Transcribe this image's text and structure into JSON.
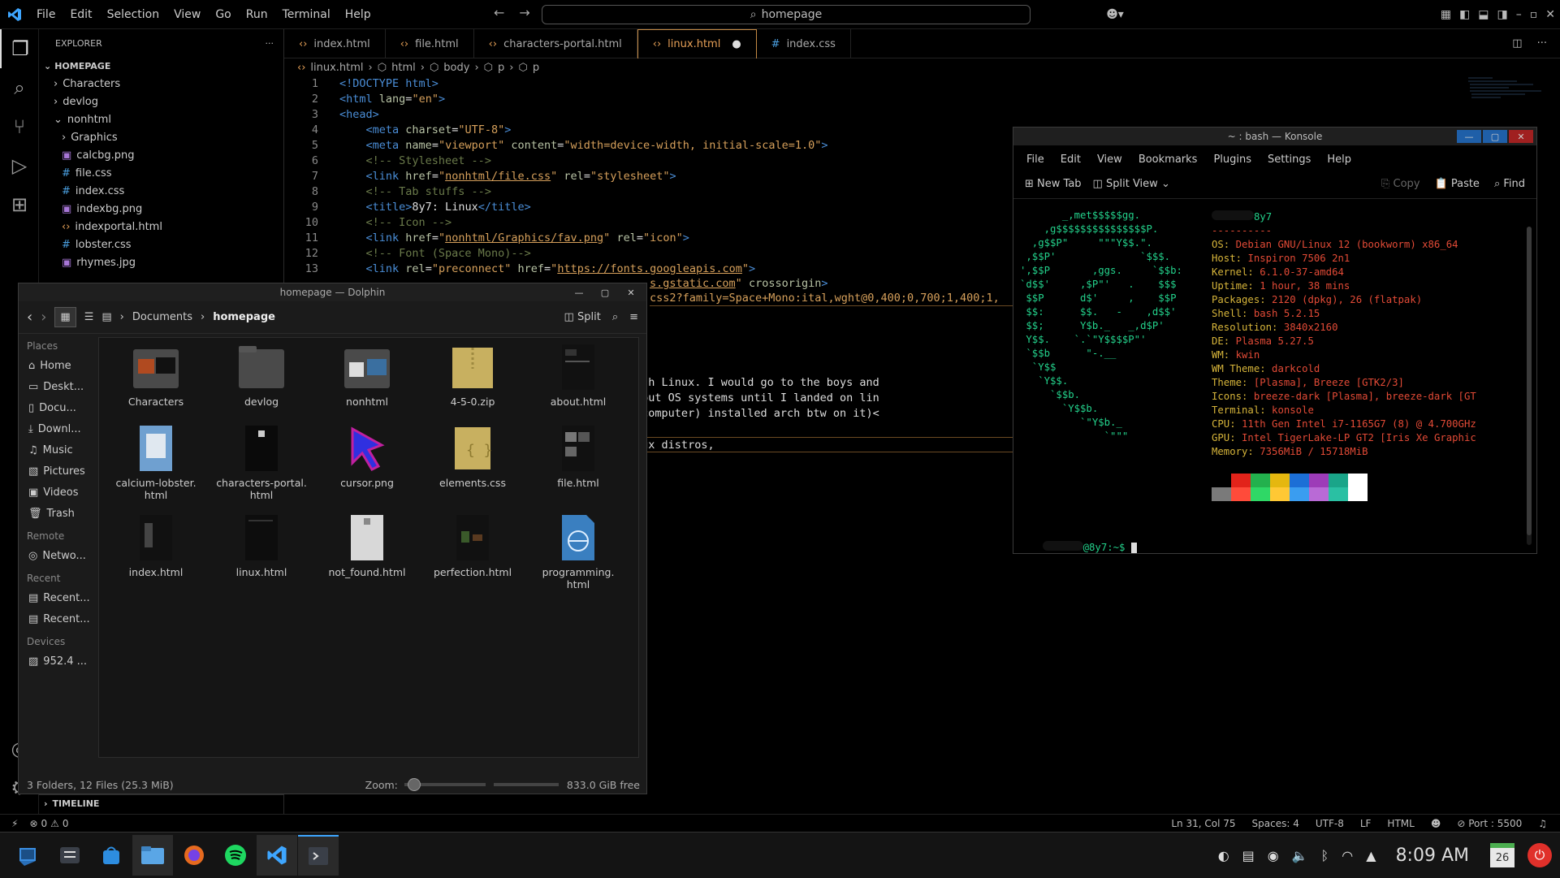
{
  "menu": [
    "File",
    "Edit",
    "Selection",
    "View",
    "Go",
    "Run",
    "Terminal",
    "Help"
  ],
  "command_center": "homepage",
  "explorer": {
    "title": "EXPLORER",
    "root": "HOMEPAGE",
    "items": [
      {
        "label": "Characters",
        "kind": "folder"
      },
      {
        "label": "devlog",
        "kind": "folder"
      },
      {
        "label": "nonhtml",
        "kind": "folder-open"
      },
      {
        "label": "Graphics",
        "kind": "folder"
      },
      {
        "label": "calcbg.png",
        "kind": "img"
      },
      {
        "label": "file.css",
        "kind": "css"
      },
      {
        "label": "index.css",
        "kind": "css"
      },
      {
        "label": "indexbg.png",
        "kind": "img"
      },
      {
        "label": "indexportal.html",
        "kind": "html"
      },
      {
        "label": "lobster.css",
        "kind": "css"
      },
      {
        "label": "rhymes.jpg",
        "kind": "img"
      }
    ],
    "timeline": "TIMELINE"
  },
  "tabs": [
    "index.html",
    "file.html",
    "characters-portal.html",
    "linux.html",
    "index.css"
  ],
  "breadcrumb": [
    "linux.html",
    "html",
    "body",
    "p",
    "p"
  ],
  "code_lines": [
    "1",
    "2",
    "3",
    "4",
    "5",
    "6",
    "7",
    "8",
    "9",
    "10",
    "11",
    "12",
    "13"
  ],
  "code_right": [
    "css2?family=Space+Mono:ital,wght@0,400;0,700;1,400;1,",
    "ame infatuated with Linux. I would go to the boys and",
    "uter for testing out OS systems until I landed on lin",
    "a different club computer) installed arch btw on it)<",
    "rfixation for linux distros,"
  ],
  "statusbar": {
    "errors": "0",
    "warnings": "0",
    "position": "Ln 31, Col 75",
    "spaces": "Spaces: 4",
    "encoding": "UTF-8",
    "eol": "LF",
    "language": "HTML",
    "port": "Port : 5500"
  },
  "dolphin": {
    "title": "homepage — Dolphin",
    "path": [
      "Documents",
      "homepage"
    ],
    "split": "Split",
    "places_head": "Places",
    "places": [
      "Home",
      "Deskt...",
      "Docu...",
      "Downl...",
      "Music",
      "Pictures",
      "Videos",
      "Trash"
    ],
    "remote_head": "Remote",
    "remote": [
      "Netwo..."
    ],
    "recent_head": "Recent",
    "recent": [
      "Recent...",
      "Recent..."
    ],
    "devices_head": "Devices",
    "devices": [
      "952.4 ..."
    ],
    "files": [
      "Characters",
      "devlog",
      "nonhtml",
      "4-5-0.zip",
      "about.html",
      "calcium-lobster.\nhtml",
      "characters-portal.\nhtml",
      "cursor.png",
      "elements.css",
      "file.html",
      "index.html",
      "linux.html",
      "not_found.html",
      "perfection.html",
      "programming.\nhtml"
    ],
    "status": "3 Folders, 12 Files (25.3 MiB)",
    "zoom_label": "Zoom:",
    "free": "833.0 GiB free"
  },
  "konsole": {
    "title": "~ : bash — Konsole",
    "menu": [
      "File",
      "Edit",
      "View",
      "Bookmarks",
      "Plugins",
      "Settings",
      "Help"
    ],
    "toolbar": [
      "New Tab",
      "Split View",
      "Copy",
      "Paste",
      "Find"
    ],
    "host": "8y7",
    "separator": "----------",
    "info": [
      [
        "OS:",
        "Debian GNU/Linux 12 (bookworm) x86_64"
      ],
      [
        "Host:",
        "Inspiron 7506 2n1"
      ],
      [
        "Kernel:",
        "6.1.0-37-amd64"
      ],
      [
        "Uptime:",
        "1 hour, 38 mins"
      ],
      [
        "Packages:",
        "2120 (dpkg), 26 (flatpak)"
      ],
      [
        "Shell:",
        "bash 5.2.15"
      ],
      [
        "Resolution:",
        "3840x2160"
      ],
      [
        "DE:",
        "Plasma 5.27.5"
      ],
      [
        "WM:",
        "kwin"
      ],
      [
        "WM Theme:",
        "darkcold"
      ],
      [
        "Theme:",
        "[Plasma], Breeze [GTK2/3]"
      ],
      [
        "Icons:",
        "breeze-dark [Plasma], breeze-dark [GT"
      ],
      [
        "Terminal:",
        "konsole"
      ],
      [
        "CPU:",
        "11th Gen Intel i7-1165G7 (8) @ 4.700GHz"
      ],
      [
        "GPU:",
        "Intel TigerLake-LP GT2 [Iris Xe Graphic"
      ],
      [
        "Memory:",
        "7356MiB / 15718MiB"
      ]
    ],
    "prompt": "@8y7:~$"
  },
  "clock": "8:09 AM",
  "calendar_day": "26"
}
